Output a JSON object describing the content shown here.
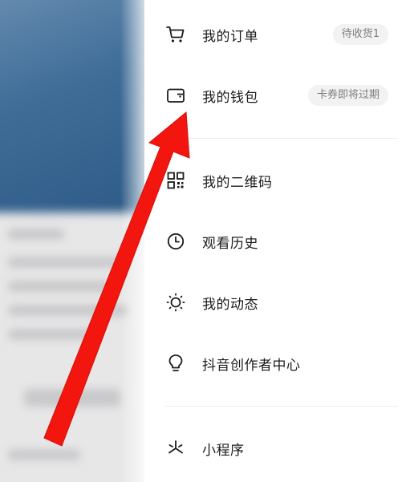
{
  "menu": {
    "orders": {
      "label": "我的订单",
      "badge": "待收货1",
      "icon": "cart-icon"
    },
    "wallet": {
      "label": "我的钱包",
      "badge": "卡券即将过期",
      "icon": "wallet-icon"
    },
    "qrcode": {
      "label": "我的二维码",
      "icon": "qrcode-icon"
    },
    "history": {
      "label": "观看历史",
      "icon": "clock-icon"
    },
    "moments": {
      "label": "我的动态",
      "icon": "sun-icon"
    },
    "creator": {
      "label": "抖音创作者中心",
      "icon": "lightbulb-icon"
    },
    "miniprogram": {
      "label": "小程序",
      "icon": "asterisk-icon"
    }
  },
  "colors": {
    "arrow": "#f2160f",
    "text": "#1c1c1c",
    "badge_bg": "#f2f2f3",
    "badge_text": "#7d7d80"
  }
}
